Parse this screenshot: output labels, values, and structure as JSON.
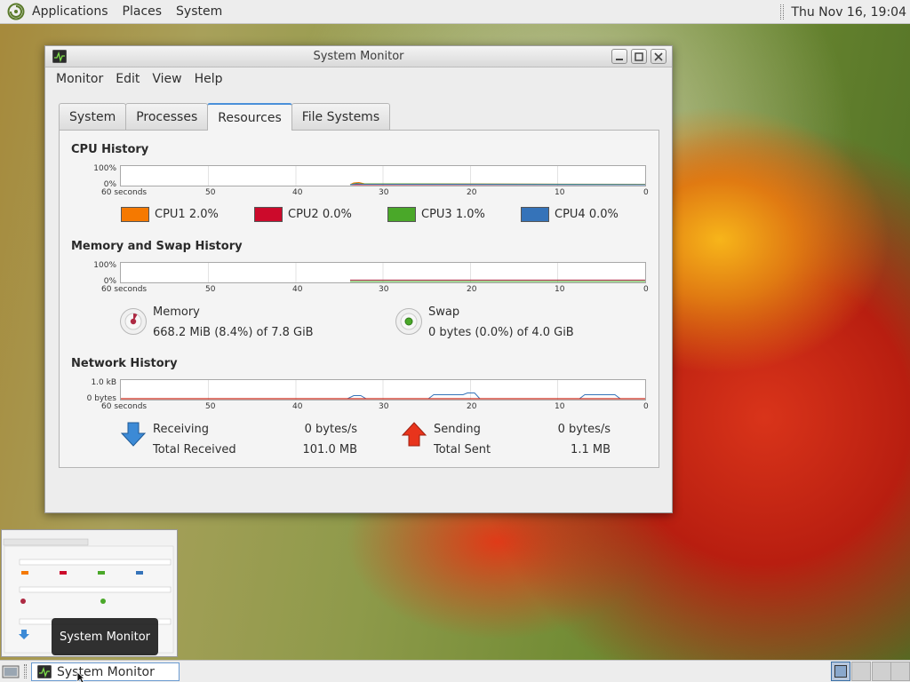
{
  "topbar": {
    "menus": [
      "Applications",
      "Places",
      "System"
    ],
    "clock": "Thu Nov 16, 19:04"
  },
  "window": {
    "title": "System Monitor",
    "menubar": [
      "Monitor",
      "Edit",
      "View",
      "Help"
    ],
    "tabs": [
      "System",
      "Processes",
      "Resources",
      "File Systems"
    ],
    "active_tab": "Resources"
  },
  "cpu": {
    "section_title": "CPU History",
    "y_top": "100%",
    "y_bottom": "0%",
    "x_ticks": [
      "60 seconds",
      "50",
      "40",
      "30",
      "20",
      "10",
      "0"
    ],
    "cores": [
      {
        "label": "CPU1",
        "value": "2.0%",
        "color": "#f57900"
      },
      {
        "label": "CPU2",
        "value": "0.0%",
        "color": "#cc0a2b"
      },
      {
        "label": "CPU3",
        "value": "1.0%",
        "color": "#4aa829"
      },
      {
        "label": "CPU4",
        "value": "0.0%",
        "color": "#3573b9"
      }
    ]
  },
  "memory": {
    "section_title": "Memory and Swap History",
    "y_top": "100%",
    "y_bottom": "0%",
    "x_ticks": [
      "60 seconds",
      "50",
      "40",
      "30",
      "20",
      "10",
      "0"
    ],
    "memory_label": "Memory",
    "memory_value": "668.2 MiB (8.4%) of 7.8 GiB",
    "memory_color": "#ad2942",
    "swap_label": "Swap",
    "swap_value": "0 bytes (0.0%) of 4.0 GiB",
    "swap_color": "#4aa829"
  },
  "network": {
    "section_title": "Network History",
    "y_top": "1.0 kB",
    "y_bottom": "0 bytes",
    "x_ticks": [
      "60 seconds",
      "50",
      "40",
      "30",
      "20",
      "10",
      "0"
    ],
    "receiving_label": "Receiving",
    "receiving_value": "0 bytes/s",
    "total_received_label": "Total Received",
    "total_received_value": "101.0 MB",
    "sending_label": "Sending",
    "sending_value": "0 bytes/s",
    "total_sent_label": "Total Sent",
    "total_sent_value": "1.1 MB",
    "receive_color": "#3573b9",
    "send_color": "#cc2a1a"
  },
  "tooltip": "System Monitor",
  "taskbar": {
    "window_button": "System Monitor"
  }
}
